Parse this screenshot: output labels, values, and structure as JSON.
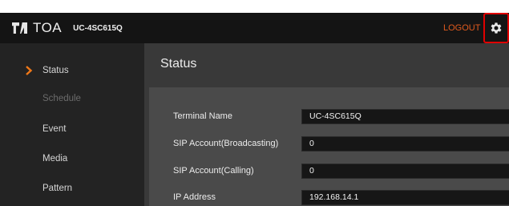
{
  "header": {
    "brand": "TOA",
    "device_model": "UC-4SC615Q",
    "logout_label": "LOGOUT",
    "settings_icon": "gear-icon",
    "accent_color": "#e05a1e",
    "highlight_color": "#e00000"
  },
  "sidebar": {
    "active_icon": "chevron-right-icon",
    "items": [
      {
        "label": "Status",
        "state": "active"
      },
      {
        "label": "Schedule",
        "state": "disabled"
      },
      {
        "label": "Event",
        "state": "normal"
      },
      {
        "label": "Media",
        "state": "normal"
      },
      {
        "label": "Pattern",
        "state": "normal"
      }
    ]
  },
  "main": {
    "title": "Status",
    "fields": [
      {
        "label": "Terminal Name",
        "value": "UC-4SC615Q"
      },
      {
        "label": "SIP Account(Broadcasting)",
        "value": "0"
      },
      {
        "label": "SIP Account(Calling)",
        "value": "0"
      },
      {
        "label": "IP Address",
        "value": "192.168.14.1"
      }
    ]
  }
}
